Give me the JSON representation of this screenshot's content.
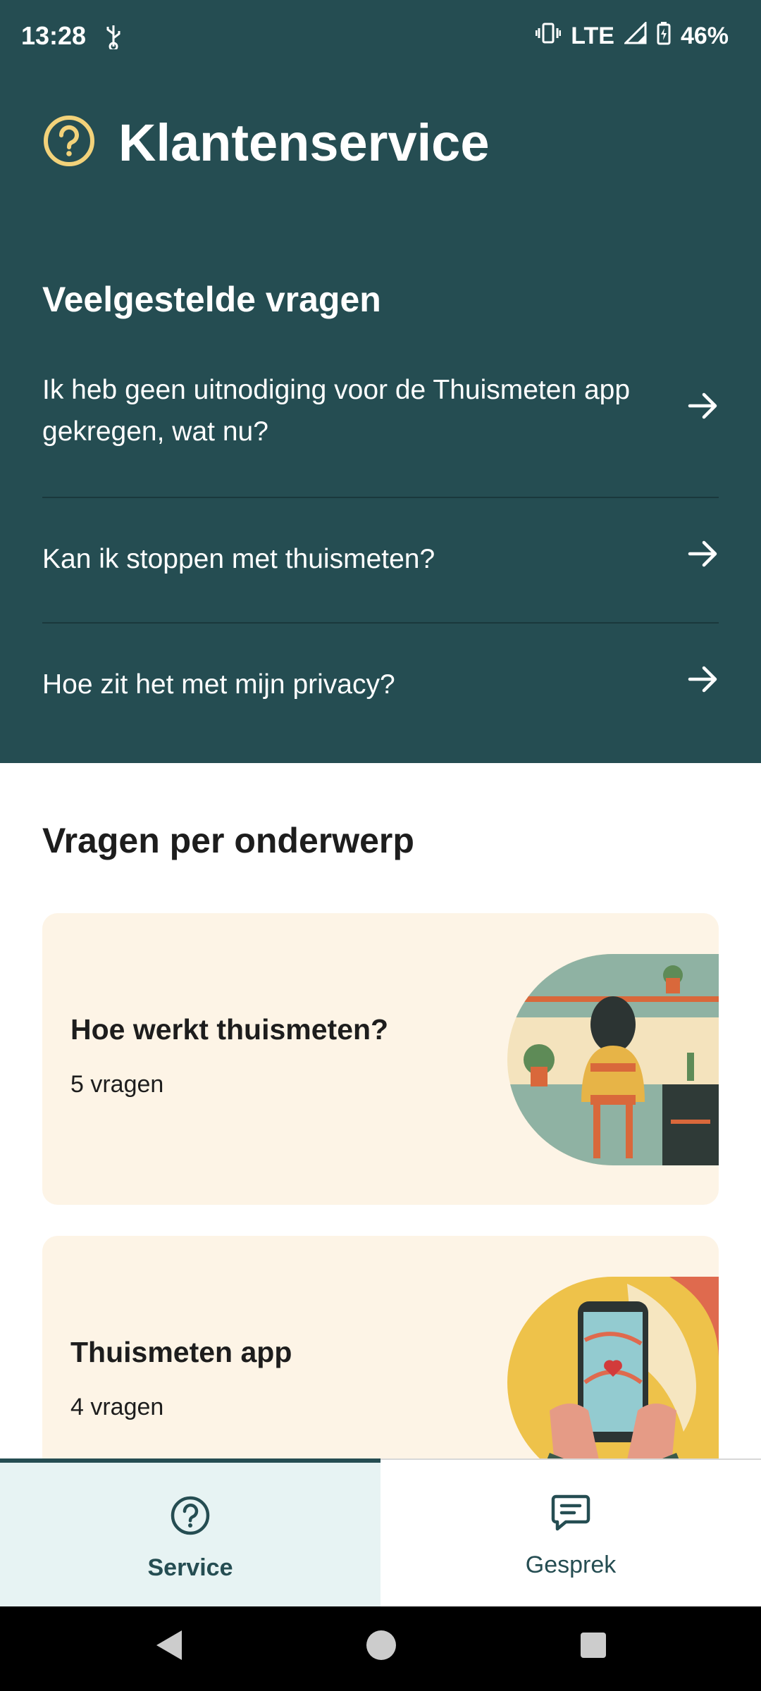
{
  "status": {
    "time": "13:28",
    "network": "LTE",
    "battery": "46%"
  },
  "header": {
    "title": "Klantenservice",
    "icon": "question-circle-icon"
  },
  "faq": {
    "title": "Veelgestelde vragen",
    "items": [
      {
        "label": "Ik heb geen uitnodiging voor de Thuismeten app gekregen, wat nu?"
      },
      {
        "label": "Kan ik stoppen met thuismeten?"
      },
      {
        "label": "Hoe zit het met mijn privacy?"
      }
    ]
  },
  "topics": {
    "title": "Vragen per onderwerp",
    "cards": [
      {
        "title": "Hoe werkt thuismeten?",
        "count": "5 vragen"
      },
      {
        "title": "Thuismeten app",
        "count": "4 vragen"
      }
    ]
  },
  "tabs": [
    {
      "label": "Service",
      "icon": "question-circle-icon",
      "active": true
    },
    {
      "label": "Gesprek",
      "icon": "chat-bubble-icon",
      "active": false
    }
  ],
  "colors": {
    "primary": "#254d52",
    "accent": "#f2d27a",
    "card": "#fdf4e6",
    "active_tab": "#e7f3f3"
  }
}
